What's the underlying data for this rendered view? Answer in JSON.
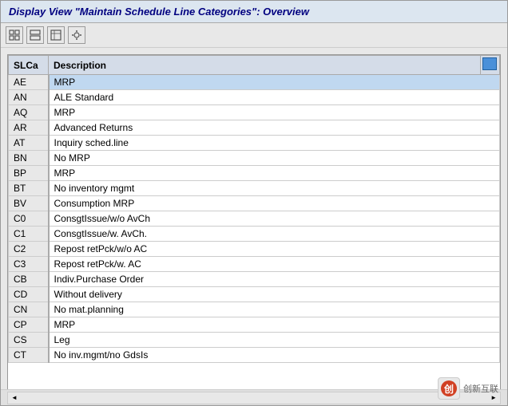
{
  "window": {
    "title": "Display View \"Maintain Schedule Line Categories\": Overview"
  },
  "toolbar": {
    "buttons": [
      {
        "id": "btn1",
        "label": "⊞",
        "name": "view-button"
      },
      {
        "id": "btn2",
        "label": "⧉",
        "name": "layout-button"
      },
      {
        "id": "btn3",
        "label": "◪",
        "name": "select-button"
      },
      {
        "id": "btn4",
        "label": "⊡",
        "name": "settings-button"
      }
    ]
  },
  "table": {
    "col_slca": "SLCa",
    "col_description": "Description",
    "rows": [
      {
        "slca": "AE",
        "description": "MRP",
        "selected": true
      },
      {
        "slca": "AN",
        "description": "ALE Standard",
        "selected": false
      },
      {
        "slca": "AQ",
        "description": "MRP",
        "selected": false
      },
      {
        "slca": "AR",
        "description": "Advanced Returns",
        "selected": false
      },
      {
        "slca": "AT",
        "description": "Inquiry sched.line",
        "selected": false
      },
      {
        "slca": "BN",
        "description": "No MRP",
        "selected": false
      },
      {
        "slca": "BP",
        "description": "MRP",
        "selected": false
      },
      {
        "slca": "BT",
        "description": "No inventory mgmt",
        "selected": false
      },
      {
        "slca": "BV",
        "description": "Consumption MRP",
        "selected": false
      },
      {
        "slca": "C0",
        "description": "ConsgtIssue/w/o AvCh",
        "selected": false
      },
      {
        "slca": "C1",
        "description": "ConsgtIssue/w. AvCh.",
        "selected": false
      },
      {
        "slca": "C2",
        "description": "Repost retPck/w/o AC",
        "selected": false
      },
      {
        "slca": "C3",
        "description": "Repost retPck/w. AC",
        "selected": false
      },
      {
        "slca": "CB",
        "description": "Indiv.Purchase Order",
        "selected": false
      },
      {
        "slca": "CD",
        "description": "Without delivery",
        "selected": false
      },
      {
        "slca": "CN",
        "description": "No mat.planning",
        "selected": false
      },
      {
        "slca": "CP",
        "description": "MRP",
        "selected": false
      },
      {
        "slca": "CS",
        "description": "Leg",
        "selected": false
      },
      {
        "slca": "CT",
        "description": "No inv.mgmt/no GdsIs",
        "selected": false
      }
    ]
  },
  "logo": {
    "symbol": "✕",
    "text": "创新互联"
  }
}
